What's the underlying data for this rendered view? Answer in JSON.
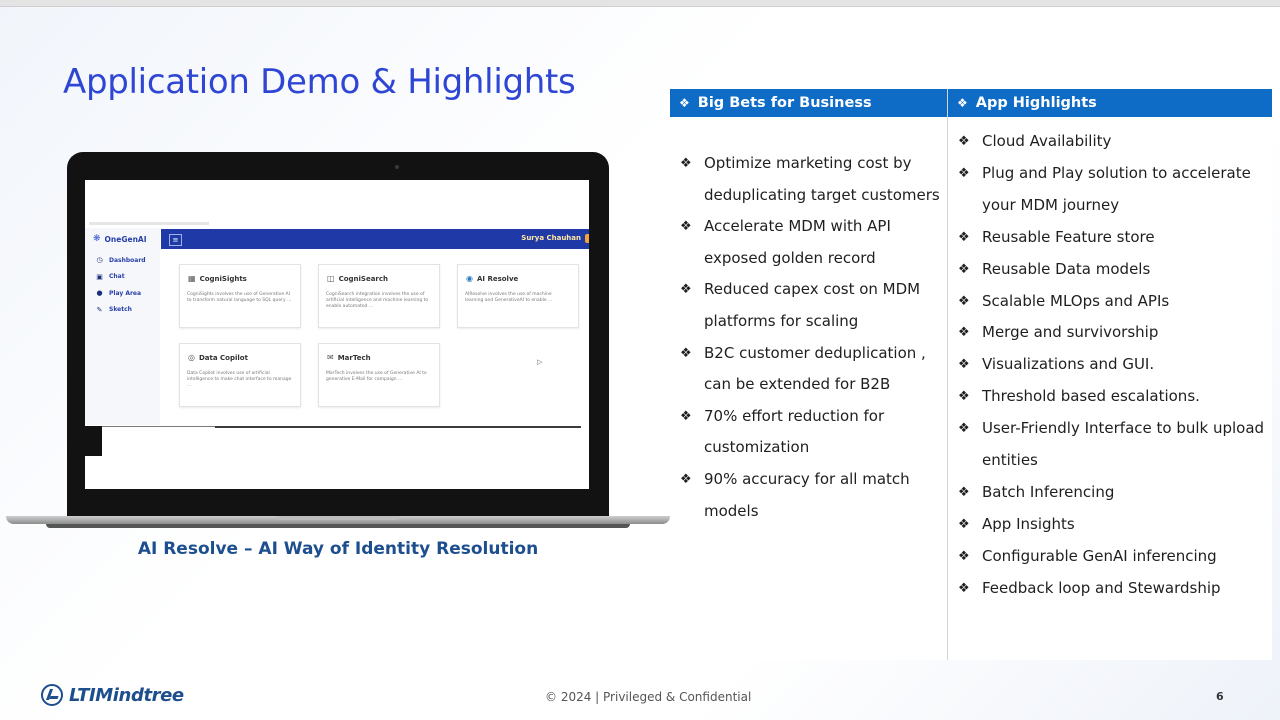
{
  "slide": {
    "title": "Application Demo & Highlights",
    "caption": "AI Resolve – AI Way of Identity Resolution"
  },
  "app": {
    "logo": "OneGenAI",
    "nav": [
      "Dashboard",
      "Chat",
      "Play Area",
      "Sketch"
    ],
    "user": "Surya Chauhan",
    "cards": [
      {
        "title": "CogniSights",
        "desc": "CogniSights involves the use of Generative AI to transform natural language to SQL query ..."
      },
      {
        "title": "CogniSearch",
        "desc": "CogniSearch integration involves the use of artificial intelligence and machine learning to enable automated ..."
      },
      {
        "title": "AI Resolve",
        "desc": "AIResolve involves the use of machine learning and GenerativeAI to enable ..."
      },
      {
        "title": "Data Copilot",
        "desc": "Data Copilot involves use of artificial intelligence to make chat interface to manage ..."
      },
      {
        "title": "MarTech",
        "desc": "MarTech involves the use of Generative AI to generative E-Mail for campaign ..."
      }
    ]
  },
  "big_bets": {
    "header": "Big Bets for Business",
    "items": [
      "Optimize marketing cost by deduplicating target customers",
      "Accelerate MDM with API exposed golden record",
      "Reduced capex cost on MDM platforms for scaling",
      "B2C customer deduplication , can be extended for B2B",
      "70% effort reduction for customization",
      "90% accuracy for all match models"
    ]
  },
  "highlights": {
    "header": "App Highlights",
    "items": [
      "Cloud Availability",
      "Plug and Play solution to accelerate your MDM journey",
      "Reusable Feature store",
      "Reusable Data models",
      "Scalable MLOps and APIs",
      "Merge and survivorship",
      "Visualizations and GUI.",
      "Threshold based escalations.",
      "User-Friendly Interface to bulk upload entities",
      "Batch Inferencing",
      "App Insights",
      "Configurable GenAI inferencing",
      "Feedback loop and Stewardship"
    ]
  },
  "footer": {
    "logo_text": "LTIMindtree",
    "text": "© 2024 | Privileged & Confidential",
    "page": "6"
  },
  "bullet_glyph": "❖",
  "colors": {
    "title": "#2f46d4",
    "header_bg": "#0f6cc6",
    "caption": "#1d4e8e",
    "app_topbar": "#1f3aa6"
  }
}
